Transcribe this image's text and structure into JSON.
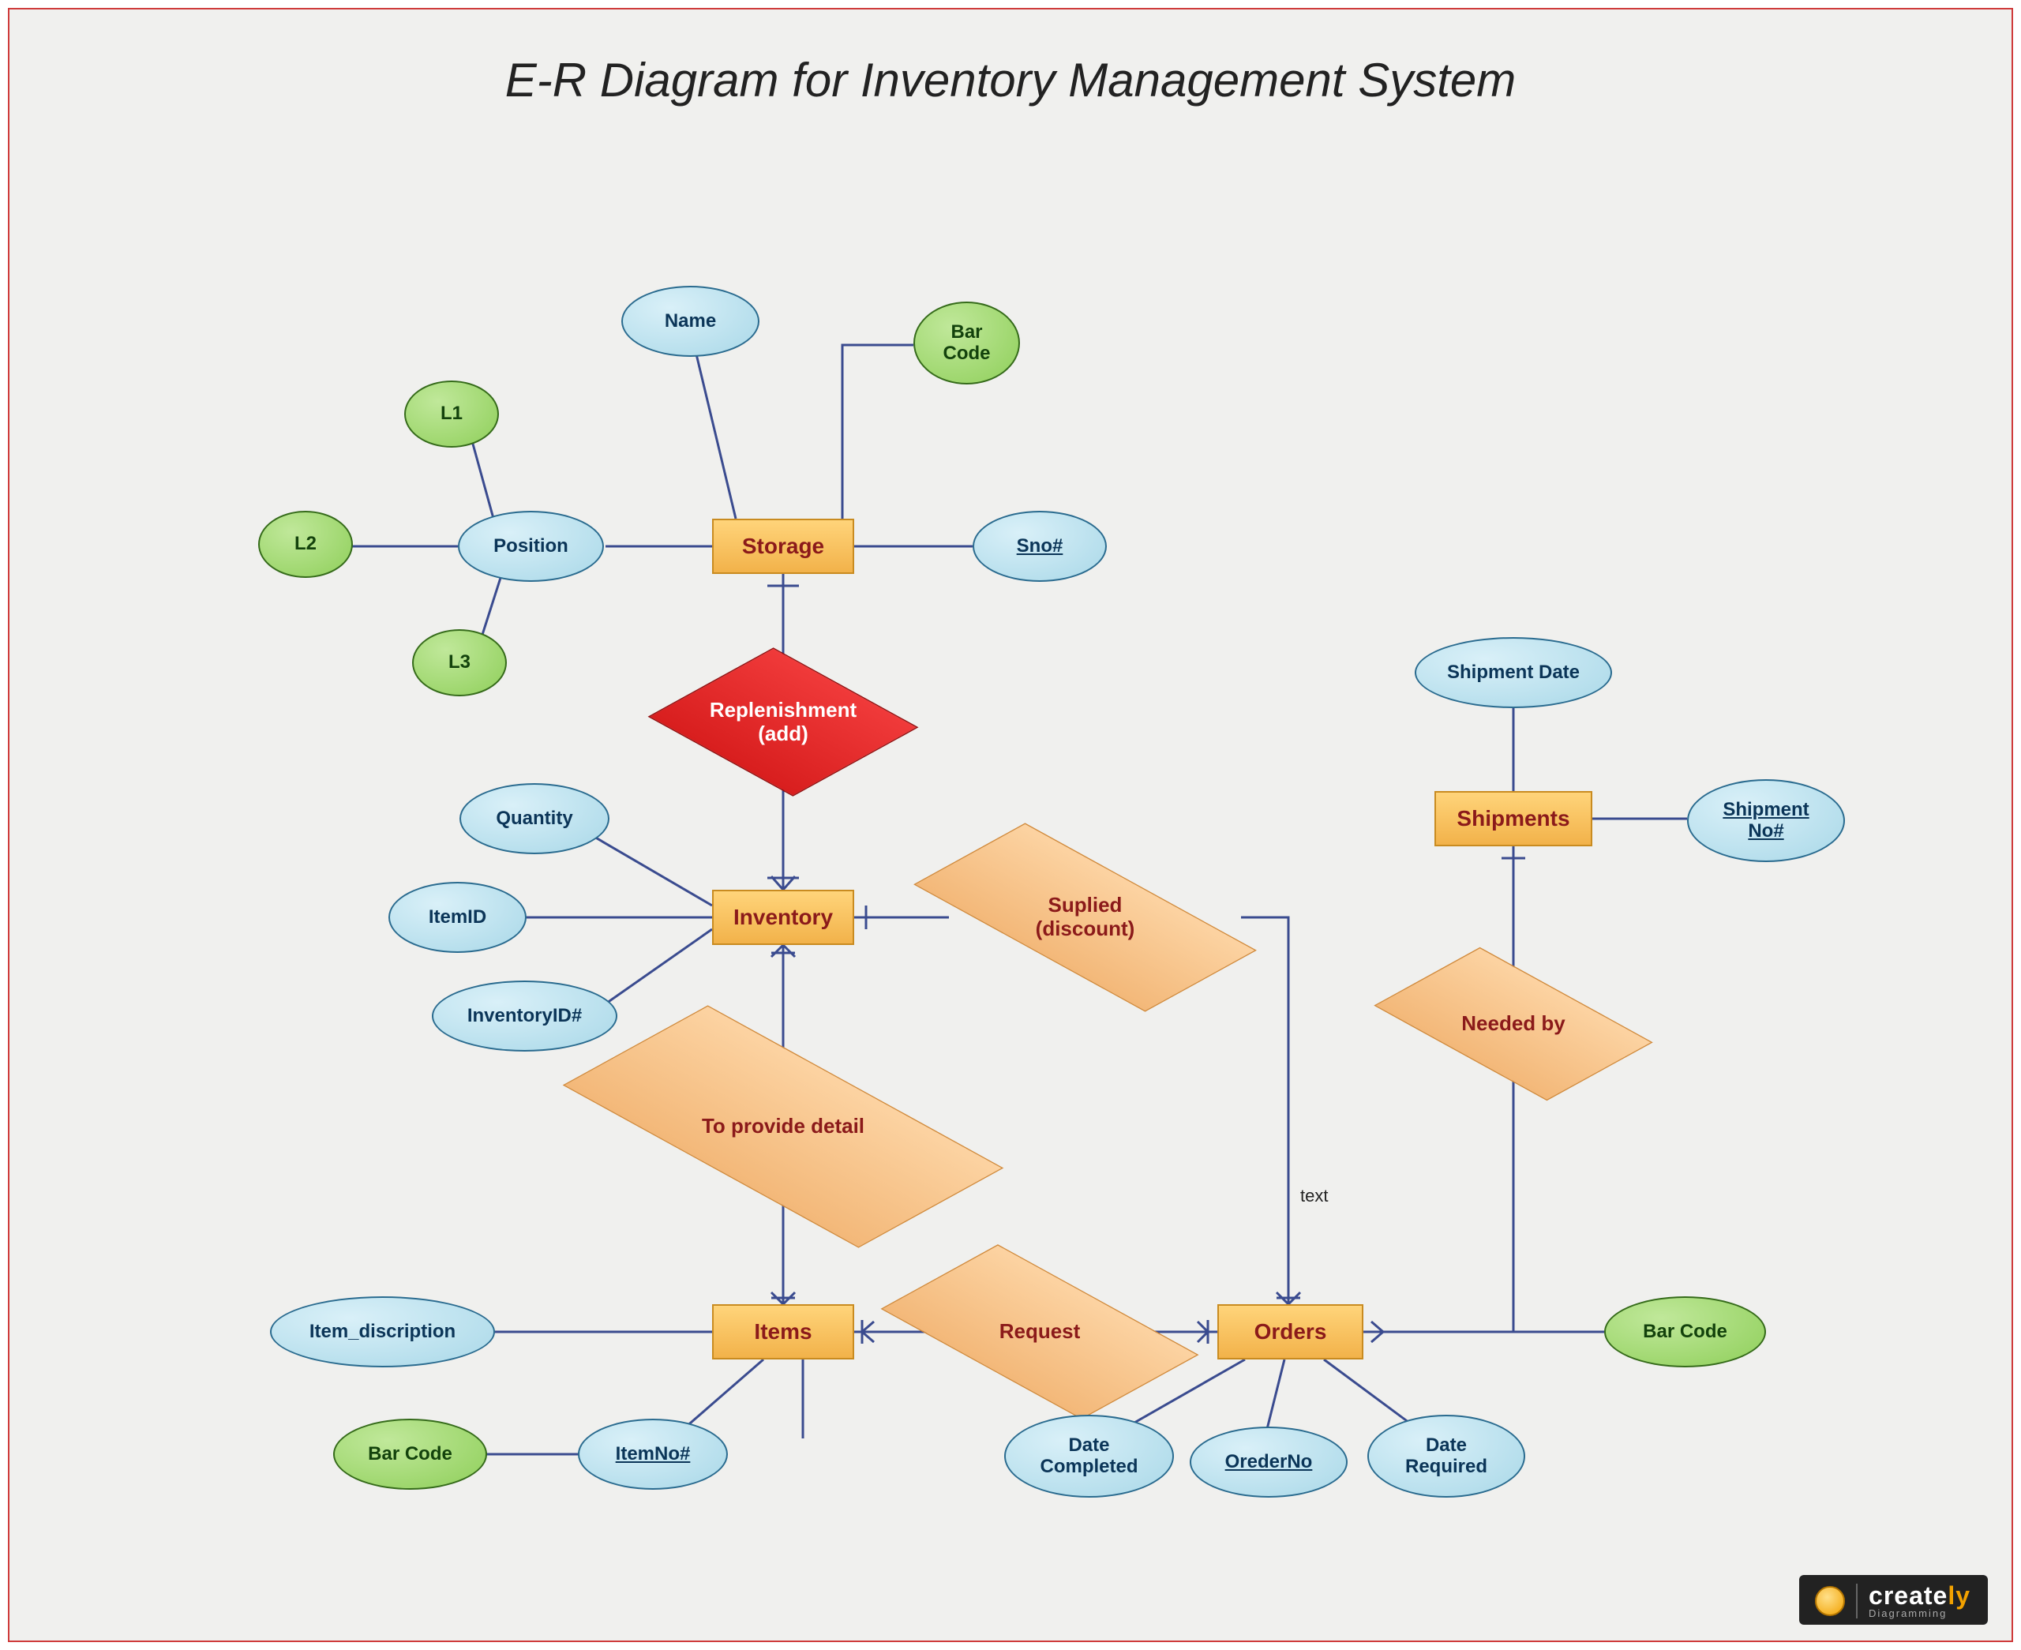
{
  "title": "E-R Diagram for Inventory Management System",
  "entities": {
    "storage": "Storage",
    "inventory": "Inventory",
    "items": "Items",
    "orders": "Orders",
    "shipments": "Shipments"
  },
  "relationships": {
    "replenishment": "Replenishment\n(add)",
    "supplied": "Suplied\n(discount)",
    "to_provide_detail": "To provide detail",
    "request": "Request",
    "needed_by": "Needed by"
  },
  "attributes": {
    "storage": {
      "name": "Name",
      "position": "Position",
      "sno": "Sno#",
      "bar_code": "Bar\nCode",
      "l1": "L1",
      "l2": "L2",
      "l3": "L3"
    },
    "inventory": {
      "quantity": "Quantity",
      "item_id": "ItemID",
      "inventory_id": "InventoryID#"
    },
    "items": {
      "item_description": "Item_discription",
      "item_no": "ItemNo#",
      "bar_code": "Bar Code"
    },
    "orders": {
      "date_completed": "Date\nCompleted",
      "order_no": "OrederNo",
      "date_required": "Date\nRequired",
      "bar_code": "Bar Code"
    },
    "shipments": {
      "shipment_date": "Shipment Date",
      "shipment_no": "Shipment\nNo#"
    }
  },
  "free_text": "text",
  "logo": {
    "brand_a": "create",
    "brand_b": "ly",
    "tag": "Diagramming"
  }
}
